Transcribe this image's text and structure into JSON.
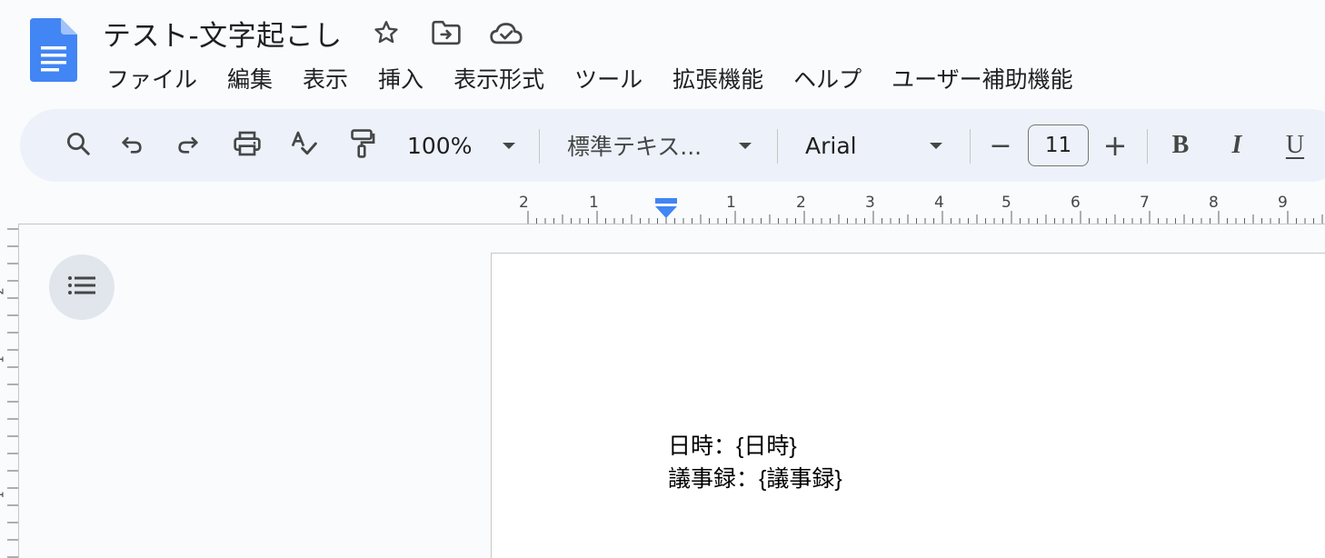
{
  "document": {
    "title": "テスト-文字起こし"
  },
  "menu": {
    "items": [
      "ファイル",
      "編集",
      "表示",
      "挿入",
      "表示形式",
      "ツール",
      "拡張機能",
      "ヘルプ",
      "ユーザー補助機能"
    ]
  },
  "toolbar": {
    "zoom": "100%",
    "paragraph_style": "標準テキス...",
    "font_family": "Arial",
    "font_size": "11",
    "decrease_label": "−",
    "increase_label": "+",
    "bold_label": "B",
    "italic_label": "I",
    "underline_label": "U"
  },
  "ruler": {
    "left_labels": [
      "2",
      "1"
    ],
    "right_labels": [
      "1",
      "2",
      "3",
      "4",
      "5",
      "6",
      "7",
      "8",
      "9"
    ],
    "vertical_labels": [
      "2",
      "1",
      "1"
    ]
  },
  "page": {
    "lines": [
      "日時：{日時}",
      "議事録：{議事録}"
    ]
  },
  "colors": {
    "accent": "#4285f4",
    "toolbar_bg": "#edf2fa",
    "page_bg": "#ffffff",
    "app_bg": "#f9fbfd"
  },
  "icons": [
    "docs-logo-icon",
    "star-icon",
    "move-to-folder-icon",
    "cloud-saved-icon",
    "search-icon",
    "undo-icon",
    "redo-icon",
    "print-icon",
    "spellcheck-icon",
    "paint-format-icon",
    "chevron-down-icon",
    "outline-icon"
  ]
}
